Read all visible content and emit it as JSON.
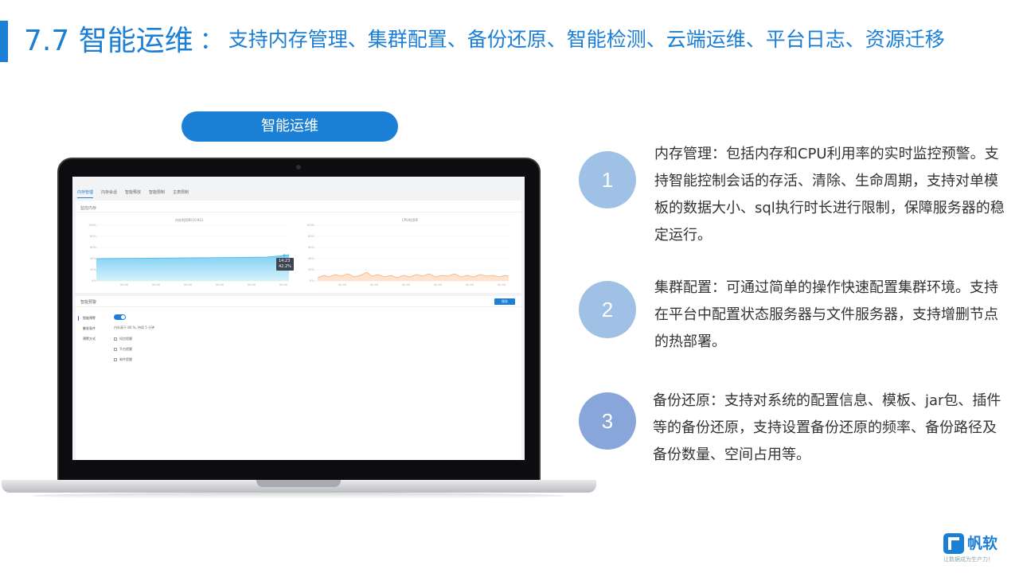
{
  "header": {
    "section": "7.7 智能运维",
    "colon": "：",
    "subtitle": "支持内存管理、集群配置、备份还原、智能检测、云端运维、平台日志、资源迁移"
  },
  "pill_label": "智能运维",
  "screen": {
    "tabs": [
      "内存管理",
      "内存会话",
      "智能释放",
      "智能限制",
      "主表限制"
    ],
    "section_label": "监控内存",
    "chart_left_title": "内存利用率(10.8G)",
    "chart_right_title": "CPU利用率",
    "y_ticks": [
      "100%",
      "80%",
      "60%",
      "40%",
      "20%",
      "0%"
    ],
    "x_ticks": [
      "00:00",
      "00:00",
      "00:00",
      "00:00",
      "00:00",
      "00:00"
    ],
    "tooltip_time": "14:23",
    "tooltip_value": "42.2%",
    "alarm_title": "智能预警",
    "save_label": "保存",
    "labels": [
      "智能预警",
      "触发条件",
      "预警方式"
    ],
    "condition": "内存高于  80   %, 持续  5      分钟",
    "channels": [
      "短信提醒",
      "平台提醒",
      "邮件提醒"
    ]
  },
  "features": [
    {
      "number": "1",
      "text": "内存管理：包括内存和CPU利用率的实时监控预警。支持智能控制会话的存活、清除、生命周期，支持对单模板的数据大小、sql执行时长进行限制，保障服务器的稳定运行。"
    },
    {
      "number": "2",
      "text": "集群配置：可通过简单的操作快速配置集群环境。支持在平台中配置状态服务器与文件服务器，支持增删节点的热部署。"
    },
    {
      "number": "3",
      "text": "备份还原：支持对系统的配置信息、模板、jar包、插件等的备份还原，支持设置备份还原的频率、备份路径及备份数量、空间占用等。"
    }
  ],
  "logo": {
    "name": "帆软",
    "slogan": "让数据成为生产力！"
  },
  "colors": {
    "accent": "#1b7fd6",
    "circle_light": "#9fc1e6",
    "circle_dark": "#88a6d9"
  }
}
